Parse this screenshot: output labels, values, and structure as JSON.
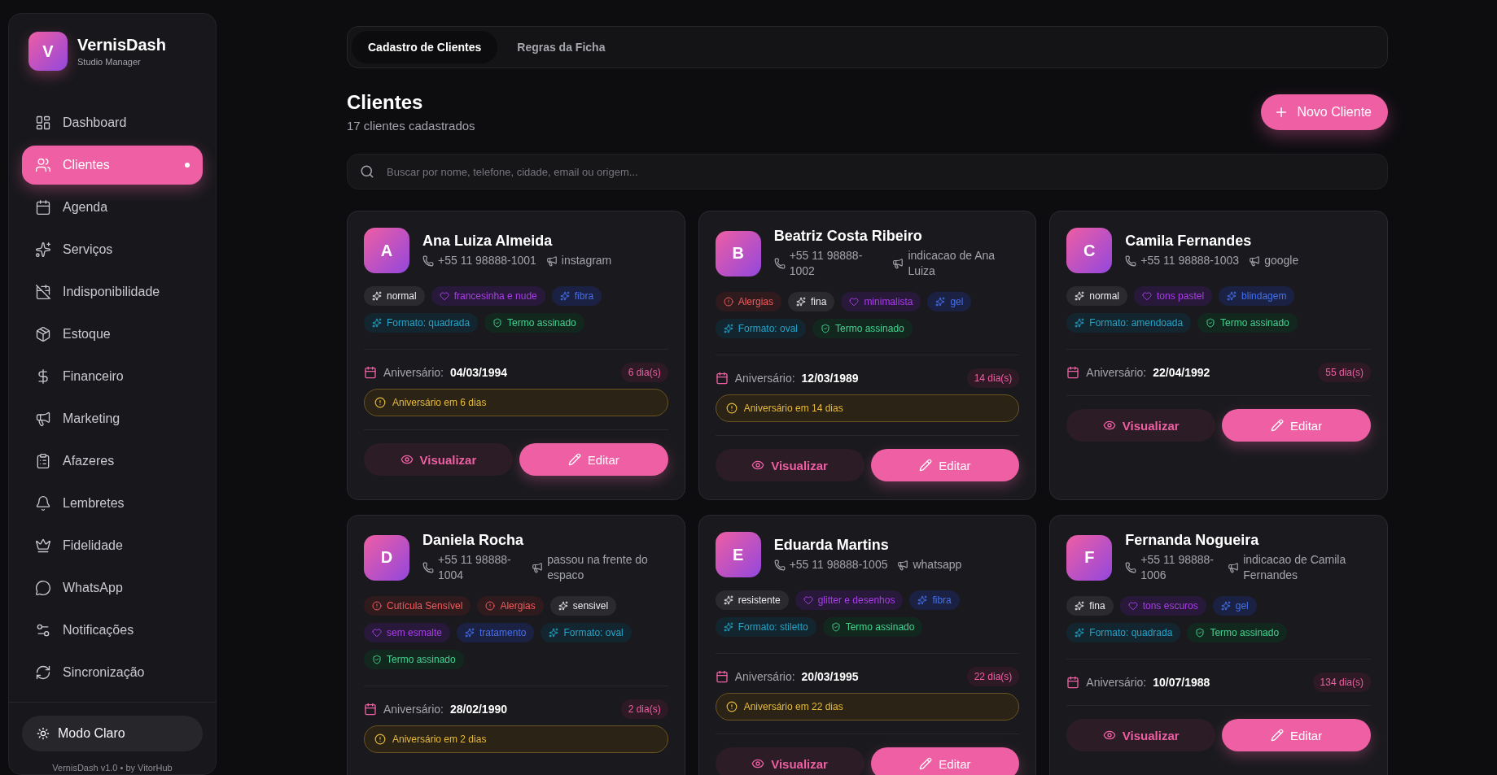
{
  "sidebar": {
    "logo_letter": "V",
    "brand": "VernisDash",
    "subtitle": "Studio Manager",
    "items": [
      {
        "label": "Dashboard",
        "selected": false
      },
      {
        "label": "Clientes",
        "selected": true
      },
      {
        "label": "Agenda",
        "selected": false
      },
      {
        "label": "Serviços",
        "selected": false
      },
      {
        "label": "Indisponibilidade",
        "selected": false
      },
      {
        "label": "Estoque",
        "selected": false
      },
      {
        "label": "Financeiro",
        "selected": false
      },
      {
        "label": "Marketing",
        "selected": false
      },
      {
        "label": "Afazeres",
        "selected": false
      },
      {
        "label": "Lembretes",
        "selected": false
      },
      {
        "label": "Fidelidade",
        "selected": false
      },
      {
        "label": "WhatsApp",
        "selected": false
      },
      {
        "label": "Notificações",
        "selected": false
      },
      {
        "label": "Sincronização",
        "selected": false
      }
    ],
    "theme_toggle": "Modo Claro",
    "footer": "VernisDash v1.0 • by VitorHub"
  },
  "tabs": [
    {
      "label": "Cadastro de Clientes",
      "selected": true
    },
    {
      "label": "Regras da Ficha",
      "selected": false
    }
  ],
  "header": {
    "title": "Clientes",
    "subtitle": "17 clientes cadastrados",
    "new_button": "Novo Cliente"
  },
  "search": {
    "placeholder": "Buscar por nome, telefone, cidade, email ou origem..."
  },
  "clients": [
    {
      "initial": "A",
      "name": "Ana Luiza Almeida",
      "phone": "+55 11 98888-1001",
      "origin": "instagram",
      "tags": [
        {
          "kind": "texture",
          "label": "normal"
        },
        {
          "kind": "style",
          "label": "francesinha e nude"
        },
        {
          "kind": "product",
          "label": "fibra"
        },
        {
          "kind": "shape",
          "label": "Formato: quadrada"
        },
        {
          "kind": "term",
          "label": "Termo assinado"
        }
      ],
      "birthday_label": "Aniversário:",
      "birthday": "04/03/1994",
      "days": "6 dia(s)",
      "alert": "Aniversário em 6 dias",
      "actions": [
        {
          "kind": "view",
          "label": "Visualizar"
        },
        {
          "kind": "edit",
          "label": "Editar"
        }
      ]
    },
    {
      "initial": "B",
      "name": "Beatriz Costa Ribeiro",
      "phone": "+55 11 98888-1002",
      "origin": "indicacao de Ana Luiza",
      "tags": [
        {
          "kind": "alert",
          "label": "Alergias"
        },
        {
          "kind": "texture",
          "label": "fina"
        },
        {
          "kind": "style",
          "label": "minimalista"
        },
        {
          "kind": "product",
          "label": "gel"
        },
        {
          "kind": "shape",
          "label": "Formato: oval"
        },
        {
          "kind": "term",
          "label": "Termo assinado"
        }
      ],
      "birthday_label": "Aniversário:",
      "birthday": "12/03/1989",
      "days": "14 dia(s)",
      "alert": "Aniversário em 14 dias",
      "actions": [
        {
          "kind": "view",
          "label": "Visualizar"
        },
        {
          "kind": "edit",
          "label": "Editar"
        }
      ]
    },
    {
      "initial": "C",
      "name": "Camila Fernandes",
      "phone": "+55 11 98888-1003",
      "origin": "google",
      "tags": [
        {
          "kind": "texture",
          "label": "normal"
        },
        {
          "kind": "style",
          "label": "tons pastel"
        },
        {
          "kind": "product",
          "label": "blindagem"
        },
        {
          "kind": "shape",
          "label": "Formato: amendoada"
        },
        {
          "kind": "term",
          "label": "Termo assinado"
        }
      ],
      "birthday_label": "Aniversário:",
      "birthday": "22/04/1992",
      "days": "55 dia(s)",
      "actions": [
        {
          "kind": "view",
          "label": "Visualizar"
        },
        {
          "kind": "edit",
          "label": "Editar"
        }
      ]
    },
    {
      "initial": "D",
      "name": "Daniela Rocha",
      "phone": "+55 11 98888-1004",
      "origin": "passou na frente do espaco",
      "tags": [
        {
          "kind": "alert",
          "label": "Cutícula Sensível"
        },
        {
          "kind": "alert",
          "label": "Alergias"
        },
        {
          "kind": "texture",
          "label": "sensivel"
        },
        {
          "kind": "style",
          "label": "sem esmalte"
        },
        {
          "kind": "product",
          "label": "tratamento"
        },
        {
          "kind": "shape",
          "label": "Formato: oval"
        },
        {
          "kind": "term",
          "label": "Termo assinado"
        }
      ],
      "birthday_label": "Aniversário:",
      "birthday": "28/02/1990",
      "days": "2 dia(s)",
      "alert": "Aniversário em 2 dias"
    },
    {
      "initial": "E",
      "name": "Eduarda Martins",
      "phone": "+55 11 98888-1005",
      "origin": "whatsapp",
      "tags": [
        {
          "kind": "texture",
          "label": "resistente"
        },
        {
          "kind": "style",
          "label": "glitter e desenhos"
        },
        {
          "kind": "product",
          "label": "fibra"
        },
        {
          "kind": "shape",
          "label": "Formato: stiletto"
        },
        {
          "kind": "term",
          "label": "Termo assinado"
        }
      ],
      "birthday_label": "Aniversário:",
      "birthday": "20/03/1995",
      "days": "22 dia(s)",
      "alert": "Aniversário em 22 dias",
      "actions": [
        {
          "kind": "view",
          "label": "Visualizar"
        },
        {
          "kind": "edit",
          "label": "Editar"
        }
      ]
    },
    {
      "initial": "F",
      "name": "Fernanda Nogueira",
      "phone": "+55 11 98888-1006",
      "origin": "indicacao de Camila Fernandes",
      "tags": [
        {
          "kind": "texture",
          "label": "fina"
        },
        {
          "kind": "style",
          "label": "tons escuros"
        },
        {
          "kind": "product",
          "label": "gel"
        },
        {
          "kind": "shape",
          "label": "Formato: quadrada"
        },
        {
          "kind": "term",
          "label": "Termo assinado"
        }
      ],
      "birthday_label": "Aniversário:",
      "birthday": "10/07/1988",
      "days": "134 dia(s)",
      "actions": [
        {
          "kind": "view",
          "label": "Visualizar"
        },
        {
          "kind": "edit",
          "label": "Editar"
        }
      ]
    }
  ]
}
